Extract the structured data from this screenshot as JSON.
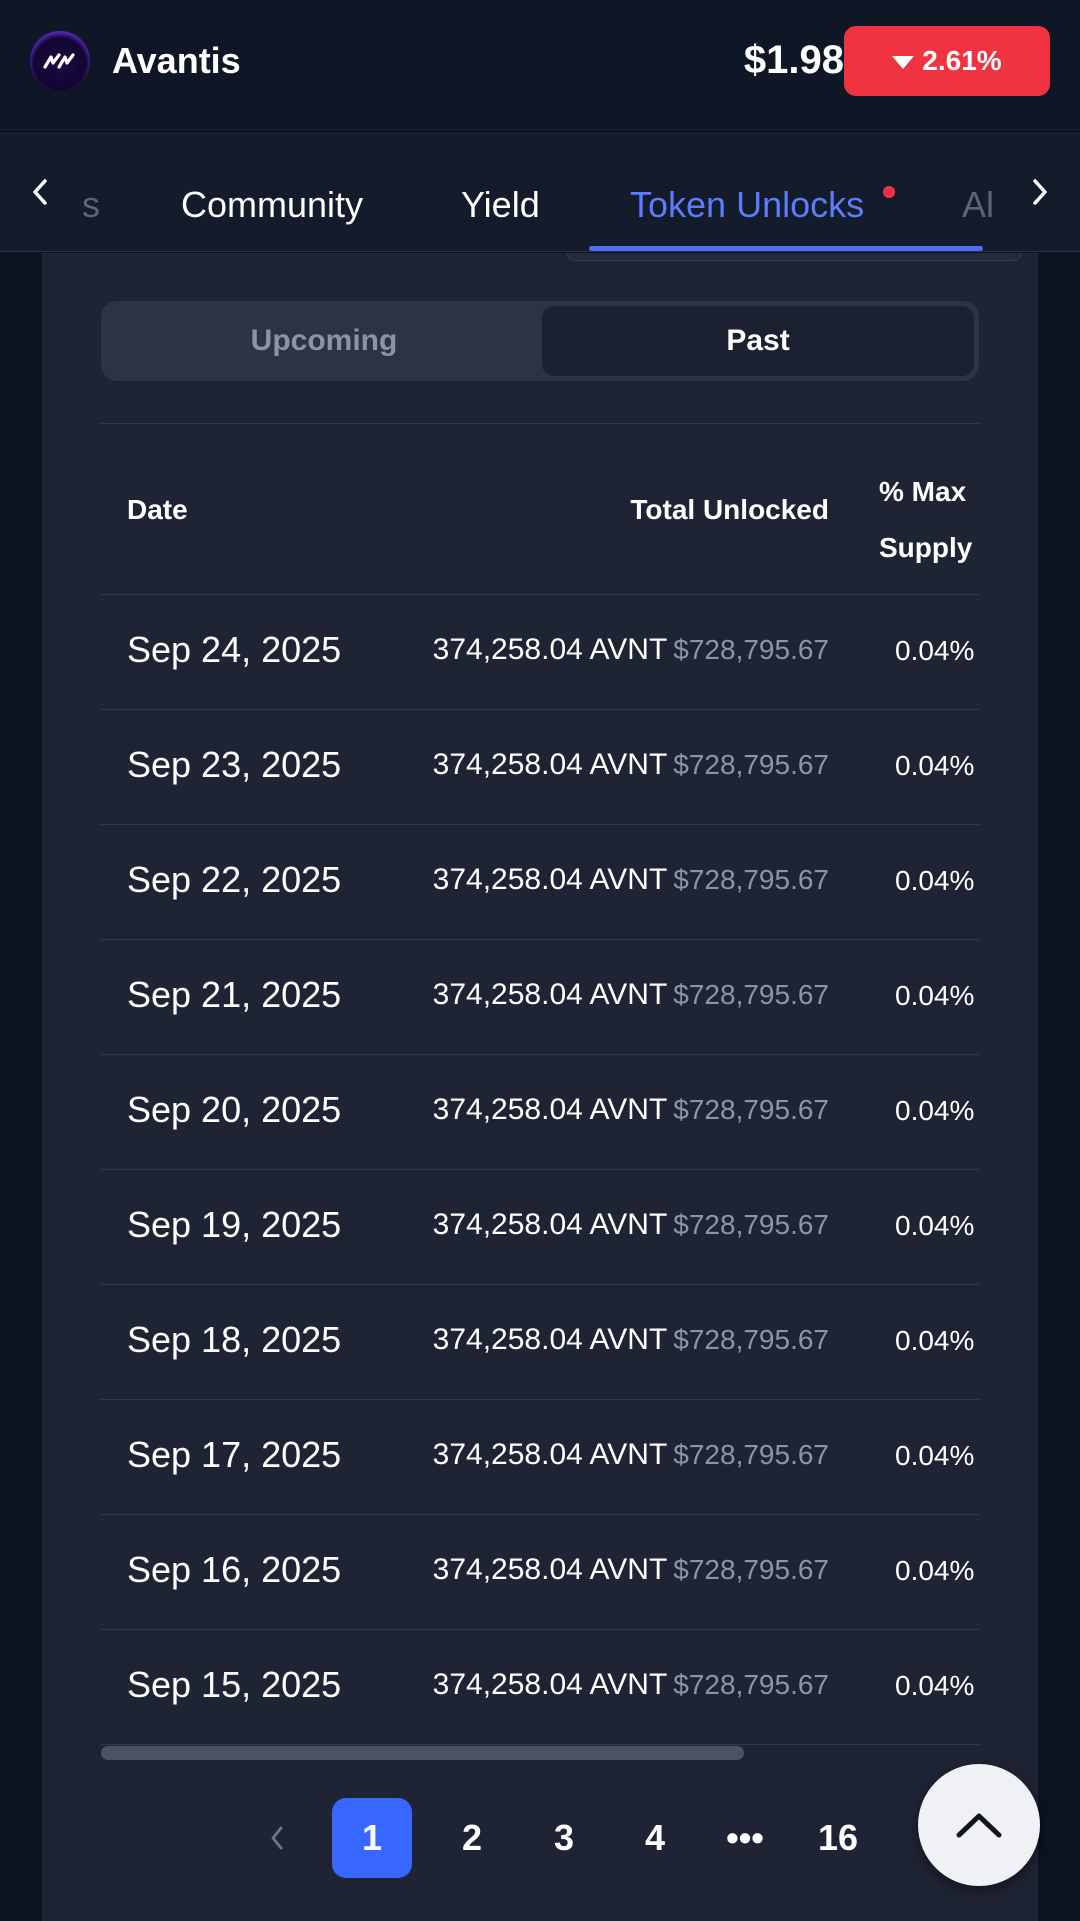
{
  "header": {
    "app_name": "Avantis",
    "price": "$1.98",
    "change": "2.61%",
    "change_direction": "down",
    "change_color": "#ef3340",
    "logo_icon": "avantis-logo"
  },
  "tabs": {
    "items": [
      {
        "label": "s",
        "state": "faded"
      },
      {
        "label": "Community",
        "state": "normal"
      },
      {
        "label": "Yield",
        "state": "normal"
      },
      {
        "label": "Token Unlocks",
        "state": "active"
      },
      {
        "label": "Al",
        "state": "faded"
      }
    ],
    "active_color": "#5c7cfa"
  },
  "segment": {
    "options": [
      "Upcoming",
      "Past"
    ],
    "selected": "Past"
  },
  "table": {
    "headers": {
      "date": "Date",
      "total": "Total Unlocked",
      "pct_line1": "% Max",
      "pct_line2": "Supply"
    },
    "rows": [
      {
        "date": "Sep 24, 2025",
        "amount": "374,258.04 AVNT",
        "usd": "$728,795.67",
        "pct": "0.04%"
      },
      {
        "date": "Sep 23, 2025",
        "amount": "374,258.04 AVNT",
        "usd": "$728,795.67",
        "pct": "0.04%"
      },
      {
        "date": "Sep 22, 2025",
        "amount": "374,258.04 AVNT",
        "usd": "$728,795.67",
        "pct": "0.04%"
      },
      {
        "date": "Sep 21, 2025",
        "amount": "374,258.04 AVNT",
        "usd": "$728,795.67",
        "pct": "0.04%"
      },
      {
        "date": "Sep 20, 2025",
        "amount": "374,258.04 AVNT",
        "usd": "$728,795.67",
        "pct": "0.04%"
      },
      {
        "date": "Sep 19, 2025",
        "amount": "374,258.04 AVNT",
        "usd": "$728,795.67",
        "pct": "0.04%"
      },
      {
        "date": "Sep 18, 2025",
        "amount": "374,258.04 AVNT",
        "usd": "$728,795.67",
        "pct": "0.04%"
      },
      {
        "date": "Sep 17, 2025",
        "amount": "374,258.04 AVNT",
        "usd": "$728,795.67",
        "pct": "0.04%"
      },
      {
        "date": "Sep 16, 2025",
        "amount": "374,258.04 AVNT",
        "usd": "$728,795.67",
        "pct": "0.04%"
      },
      {
        "date": "Sep 15, 2025",
        "amount": "374,258.04 AVNT",
        "usd": "$728,795.67",
        "pct": "0.04%"
      }
    ]
  },
  "pagination": {
    "pages": [
      "1",
      "2",
      "3",
      "4",
      "•••",
      "16"
    ],
    "current": "1",
    "accent_color": "#3867ff"
  },
  "fab": {
    "icon": "chevron-up-icon"
  }
}
